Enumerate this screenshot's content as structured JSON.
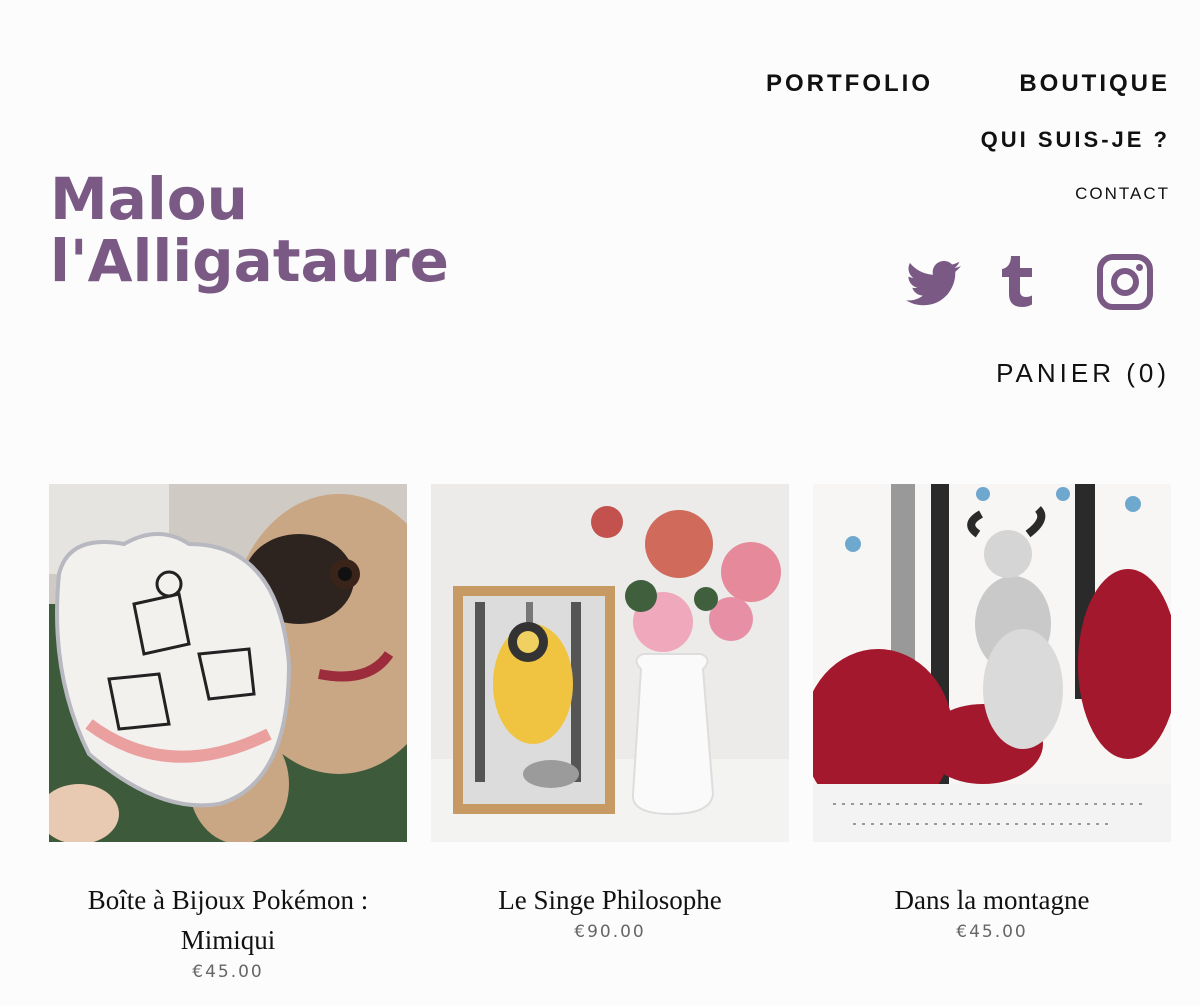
{
  "logo": {
    "line1": "Malou",
    "line2": "l'Alligataure"
  },
  "nav": {
    "portfolio": "PORTFOLIO",
    "boutique": "BOUTIQUE",
    "qui": "QUI SUIS-JE ?",
    "contact": "CONTACT",
    "cart": "PANIER (0)"
  },
  "social": [
    "twitter-icon",
    "tumblr-icon",
    "instagram-icon"
  ],
  "colors": {
    "brand": "#7a5a84",
    "text": "#111111",
    "price": "#666666"
  },
  "products": [
    {
      "title": "Boîte à Bijoux Pokémon : Mimiqui",
      "price": "€45.00"
    },
    {
      "title": "Le Singe Philosophe",
      "price": "€90.00"
    },
    {
      "title": "Dans la montagne",
      "price": "€45.00"
    }
  ]
}
